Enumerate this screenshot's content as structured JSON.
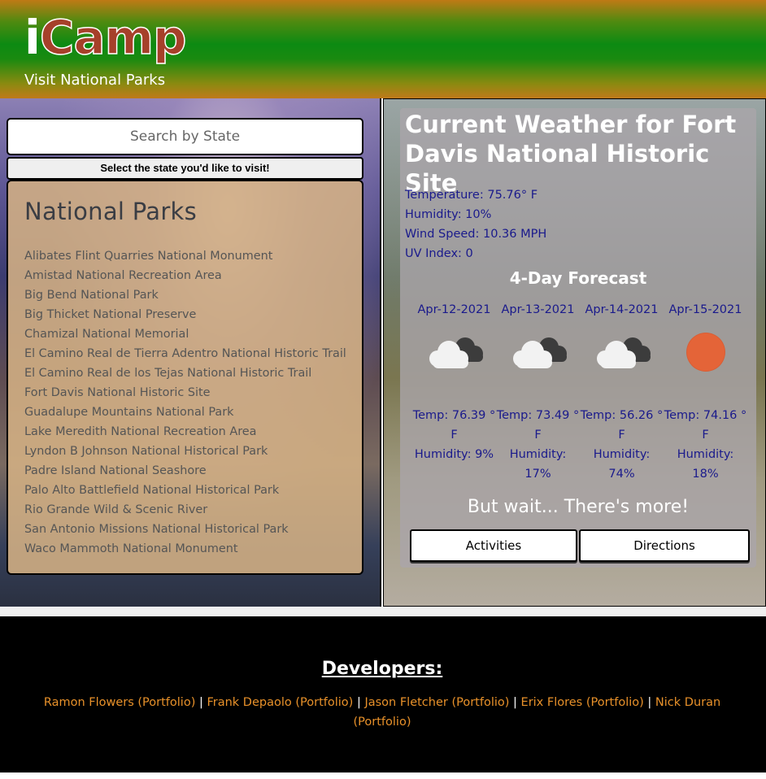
{
  "header": {
    "brand_first": "i",
    "brand_rest": "Camp",
    "tagline": "Visit National Parks"
  },
  "search": {
    "placeholder": "Search by State",
    "select_label": "Select the state you'd like to visit!"
  },
  "parks": {
    "heading": "National Parks",
    "items": [
      "Alibates Flint Quarries National Monument",
      "Amistad National Recreation Area",
      "Big Bend National Park",
      "Big Thicket National Preserve",
      "Chamizal National Memorial",
      "El Camino Real de Tierra Adentro National Historic Trail",
      "El Camino Real de los Tejas National Historic Trail",
      "Fort Davis National Historic Site",
      "Guadalupe Mountains National Park",
      "Lake Meredith National Recreation Area",
      "Lyndon B Johnson National Historical Park",
      "Padre Island National Seashore",
      "Palo Alto Battlefield National Historical Park",
      "Rio Grande Wild & Scenic River",
      "San Antonio Missions National Historical Park",
      "Waco Mammoth National Monument"
    ]
  },
  "weather": {
    "title": "Current Weather for Fort Davis National Historic Site",
    "temperature": "Temperature: 75.76° F",
    "humidity": "Humidity: 10%",
    "wind": "Wind Speed: 10.36 MPH",
    "uv": "UV Index: 0",
    "forecast_title": "4-Day Forecast",
    "days": [
      {
        "date": "Apr-12-2021",
        "icon": "cloudy-icon",
        "temp": "Temp: 76.39 ° F",
        "humidity": "Humidity: 9%"
      },
      {
        "date": "Apr-13-2021",
        "icon": "cloudy-icon",
        "temp": "Temp: 73.49 ° F",
        "humidity": "Humidity: 17%"
      },
      {
        "date": "Apr-14-2021",
        "icon": "cloudy-icon",
        "temp": "Temp: 56.26 ° F",
        "humidity": "Humidity: 74%"
      },
      {
        "date": "Apr-15-2021",
        "icon": "sun-icon",
        "temp": "Temp: 74.16 ° F",
        "humidity": "Humidity: 18%"
      }
    ],
    "more_text": "But wait... There's more!",
    "activities_label": "Activities",
    "directions_label": "Directions"
  },
  "footer": {
    "heading": "Developers:",
    "separator": "|",
    "developers": [
      "Ramon Flowers (Portfolio)",
      "Frank Depaolo (Portfolio)",
      "Jason Fletcher (Portfolio)",
      "Erix Flores (Portfolio)",
      "Nick Duran (Portfolio)"
    ]
  },
  "colors": {
    "link": "#e8912a",
    "weather_text": "#1a1a8c",
    "brand_red": "#a6402a",
    "sun": "#e46438"
  }
}
